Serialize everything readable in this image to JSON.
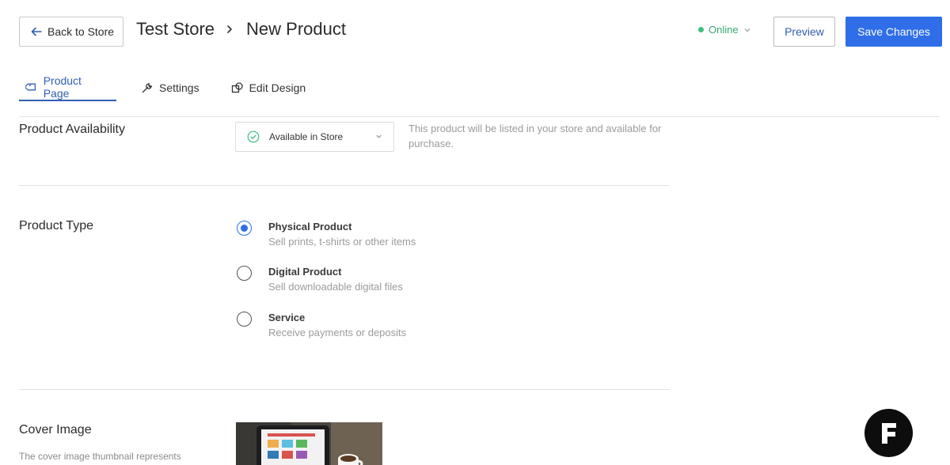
{
  "header": {
    "back_label": "Back to Store",
    "breadcrumb": [
      "Test Store",
      "New Product"
    ],
    "status_label": "Online",
    "preview_label": "Preview",
    "save_label": "Save Changes"
  },
  "tabs": [
    {
      "label": "Product Page",
      "icon": "tag-icon",
      "active": true
    },
    {
      "label": "Settings",
      "icon": "wrench-icon",
      "active": false
    },
    {
      "label": "Edit Design",
      "icon": "design-icon",
      "active": false
    }
  ],
  "availability": {
    "label": "Product Availability",
    "selected": "Available in Store",
    "help": "This product will be listed in your store and available for purchase."
  },
  "product_type": {
    "label": "Product Type",
    "options": [
      {
        "title": "Physical Product",
        "subtitle": "Sell prints, t-shirts or other items",
        "selected": true
      },
      {
        "title": "Digital Product",
        "subtitle": "Sell downloadable digital files",
        "selected": false
      },
      {
        "title": "Service",
        "subtitle": "Receive payments or deposits",
        "selected": false
      }
    ]
  },
  "cover": {
    "label": "Cover Image",
    "help": "The cover image thumbnail represents"
  },
  "colors": {
    "accent": "#2f6ee8",
    "link": "#2f5fb3",
    "online": "#3fbf7f",
    "fab": "#0d0d0d"
  }
}
